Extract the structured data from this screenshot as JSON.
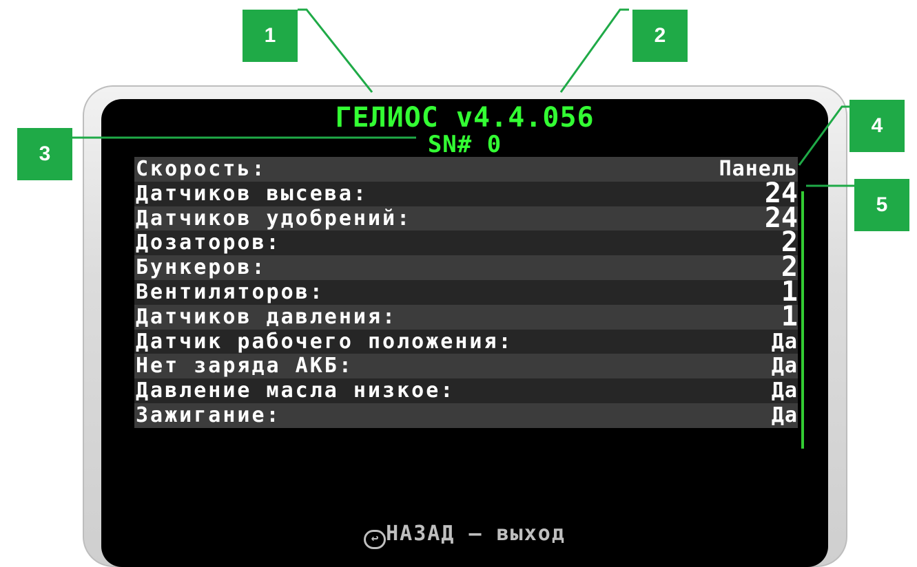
{
  "header": {
    "title": "ГЕЛИОС v4.4.056",
    "serial": "SN# 0"
  },
  "rows": [
    {
      "label": "Скорость:",
      "value": "Панель"
    },
    {
      "label": "Датчиков высева:",
      "value": "24"
    },
    {
      "label": "Датчиков удобрений:",
      "value": "24"
    },
    {
      "label": "Дозаторов:",
      "value": "2"
    },
    {
      "label": "Бункеров:",
      "value": "2"
    },
    {
      "label": "Вентиляторов:",
      "value": "1"
    },
    {
      "label": "Датчиков давления:",
      "value": "1"
    },
    {
      "label": "Датчик рабочего положения:",
      "value": "Да"
    },
    {
      "label": "Нет заряда АКБ:",
      "value": "Да"
    },
    {
      "label": "Давление масла низкое:",
      "value": "Да"
    },
    {
      "label": "Зажигание:",
      "value": "Да"
    }
  ],
  "footer": {
    "back_icon_glyph": "↩",
    "text": "НАЗАД — выход"
  },
  "callouts": [
    "1",
    "2",
    "3",
    "4",
    "5"
  ],
  "colors": {
    "title": "#33ff33",
    "callout": "#1faa47",
    "screen": "#000000"
  }
}
